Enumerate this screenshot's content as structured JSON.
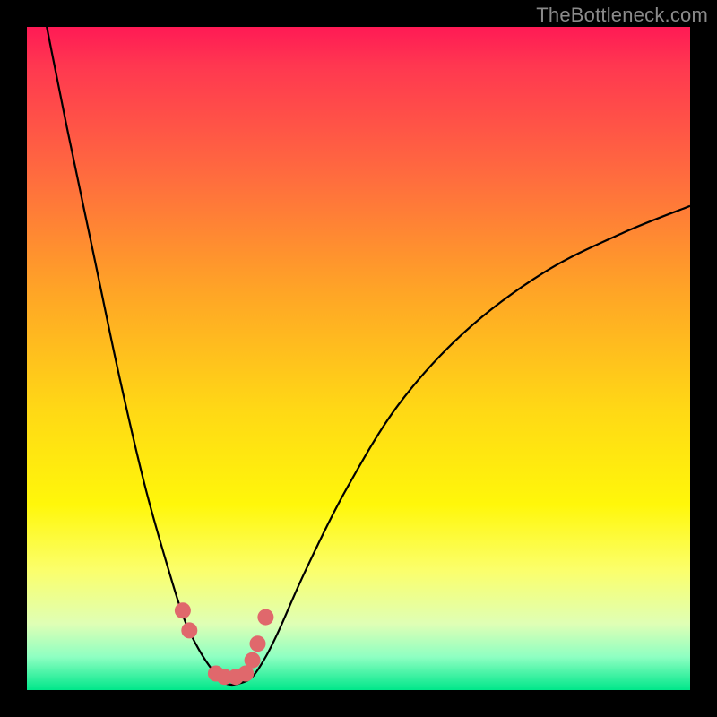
{
  "watermark": "TheBottleneck.com",
  "colors": {
    "curve": "#000000",
    "marker": "#e0686c",
    "frame": "#000000"
  },
  "chart_data": {
    "type": "line",
    "title": "",
    "xlabel": "",
    "ylabel": "",
    "xlim": [
      0,
      100
    ],
    "ylim": [
      0,
      100
    ],
    "series": [
      {
        "name": "bottleneck-curve",
        "x": [
          0,
          3,
          6,
          10,
          14,
          18,
          22,
          24,
          26,
          28,
          30,
          32,
          34,
          36,
          38,
          42,
          48,
          56,
          66,
          78,
          90,
          100
        ],
        "y": [
          115,
          100,
          85,
          66,
          47,
          30,
          16,
          10,
          6,
          3,
          1,
          1,
          2,
          5,
          9,
          18,
          30,
          43,
          54,
          63,
          69,
          73
        ]
      }
    ],
    "markers": {
      "name": "highlight-points",
      "x": [
        23.5,
        24.5,
        28.5,
        29.8,
        31.5,
        33.0,
        34.0,
        34.8,
        36.0
      ],
      "y": [
        12,
        9,
        2.5,
        2.0,
        2.0,
        2.5,
        4.5,
        7.0,
        11.0
      ]
    }
  }
}
